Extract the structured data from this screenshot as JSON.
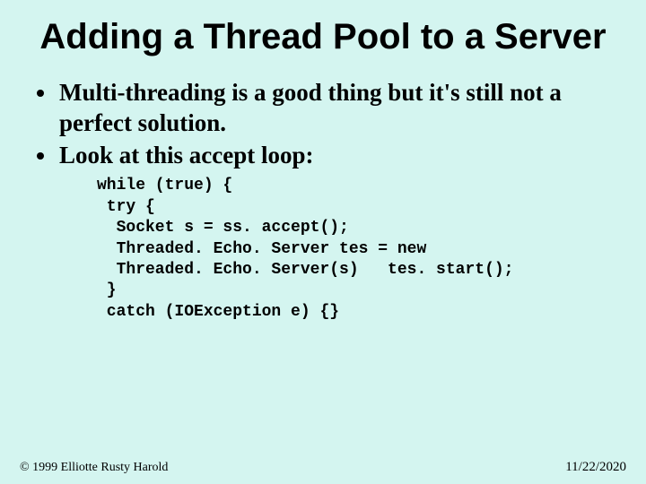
{
  "title": "Adding a Thread Pool to a Server",
  "bullets": [
    "Multi-threading is a good thing but it's still not a perfect solution.",
    "Look at this accept loop:"
  ],
  "code_lines": [
    "while (true) {",
    " try {",
    "  Socket s = ss. accept();",
    "  Threaded. Echo. Server tes = new",
    "  Threaded. Echo. Server(s)   tes. start();",
    " }",
    " catch (IOException e) {}"
  ],
  "footer": {
    "copyright": "© 1999 Elliotte Rusty Harold",
    "date": "11/22/2020"
  }
}
